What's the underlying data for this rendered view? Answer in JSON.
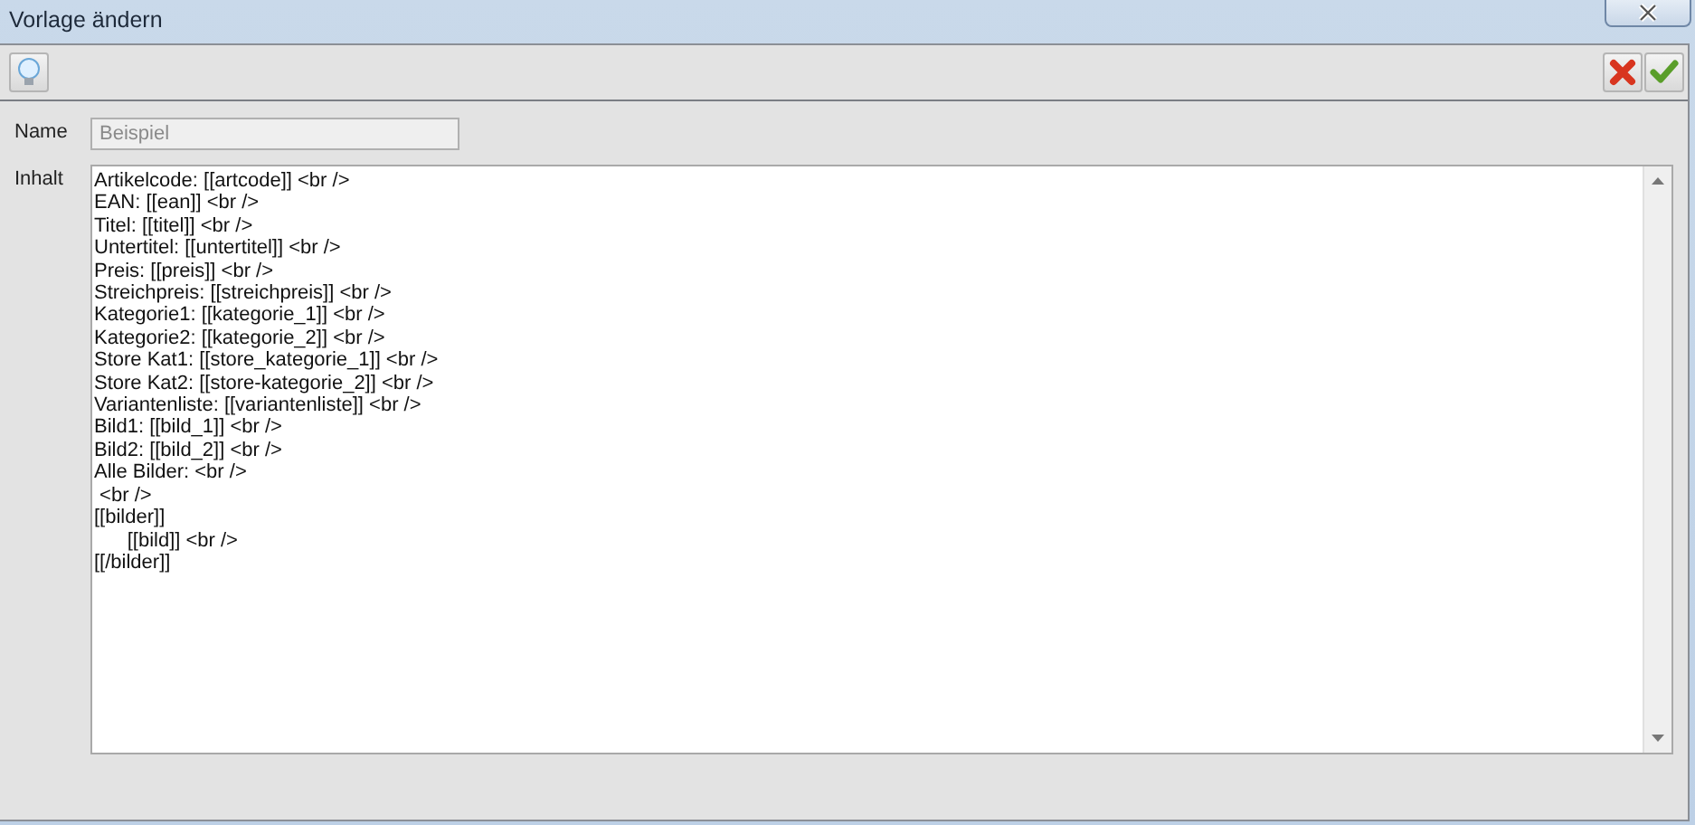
{
  "window": {
    "title": "Vorlage ändern"
  },
  "form": {
    "name_label": "Name",
    "name_value": "Beispiel",
    "name_disabled": true,
    "content_label": "Inhalt",
    "content_lines": [
      "Artikelcode: [[artcode]] <br />",
      "EAN: [[ean]] <br />",
      "Titel: [[titel]] <br />",
      "Untertitel: [[untertitel]] <br />",
      "Preis: [[preis]] <br />",
      "Streichpreis: [[streichpreis]] <br />",
      "Kategorie1: [[kategorie_1]] <br />",
      "Kategorie2: [[kategorie_2]] <br />",
      "Store Kat1: [[store_kategorie_1]] <br />",
      "Store Kat2: [[store-kategorie_2]] <br />",
      "Variantenliste: [[variantenliste]] <br />",
      "Bild1: [[bild_1]] <br />",
      "Bild2: [[bild_2]] <br />",
      "Alle Bilder: <br />",
      " <br />",
      "[[bilder]]",
      "      [[bild]] <br />",
      "[[/bilder]]"
    ]
  }
}
